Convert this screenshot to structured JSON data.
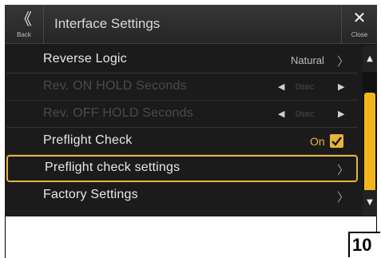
{
  "header": {
    "back_label": "Back",
    "back_glyph": "《",
    "title": "Interface Settings",
    "close_label": "Close",
    "close_glyph": "✕"
  },
  "rows": [
    {
      "label": "Reverse Logic",
      "value": "Natural",
      "chevron": "〉",
      "disabled": false
    },
    {
      "label": "Rev. ON HOLD Seconds",
      "value": "0sec",
      "left_arrow": "◀",
      "right_arrow": "▶",
      "disabled": true
    },
    {
      "label": "Rev. OFF HOLD Seconds",
      "value": "0sec",
      "left_arrow": "◀",
      "right_arrow": "▶",
      "disabled": true
    },
    {
      "label": "Preflight Check",
      "value": "On",
      "checked": true,
      "disabled": false
    },
    {
      "label": "Preflight check settings",
      "chevron": "〉",
      "selected": true
    },
    {
      "label": "Factory Settings",
      "chevron": "〉"
    }
  ],
  "scrollbar": {
    "up": "▲",
    "down": "▼"
  },
  "page_number": "10",
  "colors": {
    "accent": "#e8b53a",
    "thumb": "#f2b51c",
    "background": "#1b1b1b"
  }
}
